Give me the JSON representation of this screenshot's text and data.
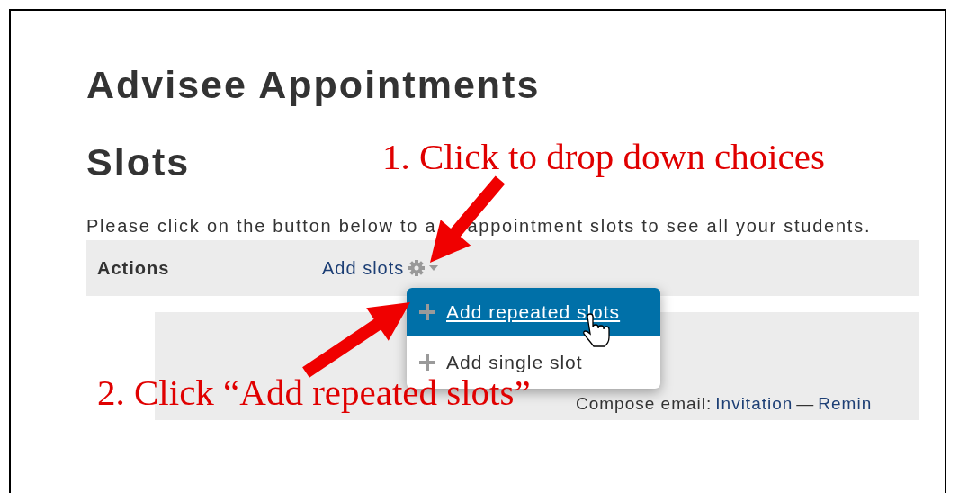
{
  "page": {
    "title": "Advisee Appointments",
    "section_title": "Slots",
    "instructions": [
      "Please click on the button below to a",
      "appointment slots to see all your students."
    ]
  },
  "actions_bar": {
    "label": "Actions",
    "menu_button": "Add slots"
  },
  "dropdown_menu": {
    "items": [
      {
        "label": "Add repeated slots",
        "selected": true
      },
      {
        "label": "Add single slot",
        "selected": false
      }
    ]
  },
  "slots_panel": {
    "compose_label": "Compose email:",
    "links": [
      "Invitation",
      "Remin"
    ],
    "separator": "—"
  },
  "annotations": [
    {
      "text": "1. Click to drop down choices"
    },
    {
      "text": "2. Click “Add repeated slots”"
    }
  ]
}
